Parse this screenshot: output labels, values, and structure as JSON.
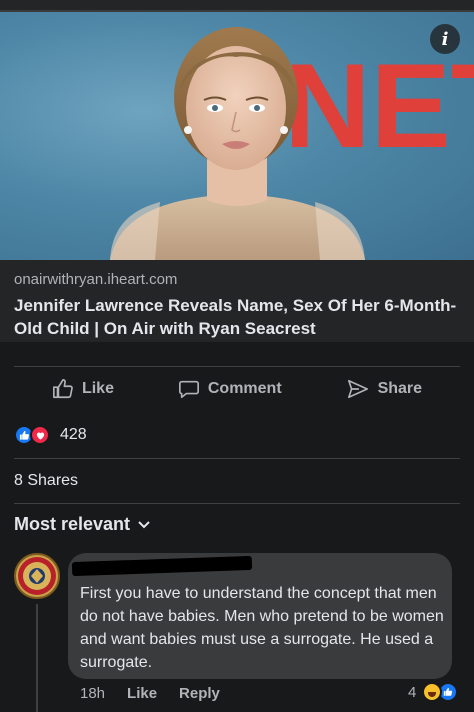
{
  "post": {
    "link_domain": "onairwithryan.iheart.com",
    "link_title": "Jennifer Lawrence Reveals Name, Sex Of Her 6-Month-Old Child | On Air with Ryan Seacrest",
    "info_icon": "i",
    "backdrop_letters": "NET"
  },
  "actions": {
    "like_label": "Like",
    "comment_label": "Comment",
    "share_label": "Share"
  },
  "reactions": {
    "count": "428",
    "types": [
      "like",
      "love"
    ]
  },
  "shares": {
    "label": "8 Shares"
  },
  "comments": {
    "sort_label": "Most relevant",
    "items": [
      {
        "author_redacted": true,
        "text": "First you have to understand the concept that men do not have babies. Men who pretend to be women and want babies must use a surrogate. He used a surrogate.",
        "time": "18h",
        "like_label": "Like",
        "reply_label": "Reply",
        "reaction_count": "4",
        "reaction_types": [
          "haha",
          "like"
        ]
      }
    ]
  },
  "colors": {
    "background": "#18191a",
    "card": "#242526",
    "bubble": "#3a3b3c",
    "like_blue": "#1877f2",
    "love_red": "#f0284a",
    "text_primary": "#e4e6eb",
    "text_secondary": "#b0b3b8"
  }
}
